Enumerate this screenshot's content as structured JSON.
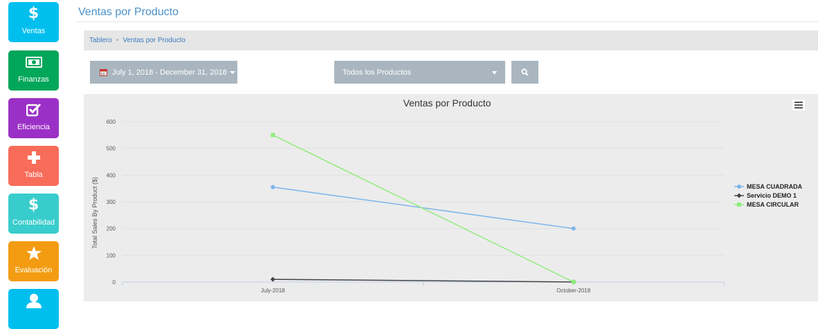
{
  "sidebar": {
    "items": [
      {
        "label": "Ventas",
        "color": "#00bfef",
        "icon": "dollar-icon",
        "glyph": "$"
      },
      {
        "label": "Finanzas",
        "color": "#00a65a",
        "icon": "money-bill-icon",
        "glyph": ""
      },
      {
        "label": "Eficiencia",
        "color": "#9b30c6",
        "icon": "checkbox-icon",
        "glyph": ""
      },
      {
        "label": "Tabla",
        "color": "#f86c5a",
        "icon": "plus-icon",
        "glyph": ""
      },
      {
        "label": "Contabilidad",
        "color": "#39cccc",
        "icon": "dollar-icon",
        "glyph": "$"
      },
      {
        "label": "Evaluación",
        "color": "#f39c12",
        "icon": "star-icon",
        "glyph": ""
      },
      {
        "label": "",
        "color": "#00bfef",
        "icon": "user-icon",
        "glyph": ""
      }
    ]
  },
  "header": {
    "title": "Ventas por Producto"
  },
  "breadcrumb": {
    "home": "Tablero",
    "current": "Ventas por Producto"
  },
  "filters": {
    "date_range": "July 1, 2018 - December 31, 2018",
    "product": "Todos los Productos"
  },
  "chart_data": {
    "type": "line",
    "title": "Ventas por Producto",
    "ylabel": "Total Sales By Product ($)",
    "xlabel": "",
    "categories": [
      "July-2018",
      "October-2018"
    ],
    "ylim": [
      0,
      600
    ],
    "yticks": [
      0,
      100,
      200,
      300,
      400,
      500,
      600
    ],
    "grid": true,
    "legend_position": "right",
    "series": [
      {
        "name": "MESA CUADRADA",
        "values": [
          355,
          200
        ],
        "color": "#7cb5ec",
        "marker": "circle"
      },
      {
        "name": "Servicio DEMO 1",
        "values": [
          10,
          0
        ],
        "color": "#434348",
        "marker": "diamond"
      },
      {
        "name": "MESA CIRCULAR",
        "values": [
          550,
          0
        ],
        "color": "#90ed7d",
        "marker": "square"
      }
    ]
  }
}
